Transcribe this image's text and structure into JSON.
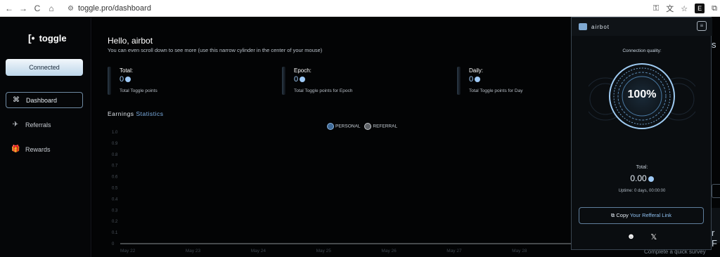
{
  "browser": {
    "url": "toggle.pro/dashboard",
    "nav_back": "←",
    "nav_forward": "→",
    "nav_reload": "C",
    "nav_home": "⌂",
    "star": "☆",
    "ext_label": "E"
  },
  "sidebar": {
    "logo_text": "toggle",
    "logo_mark": "[•",
    "connected_label": "Connected",
    "items": [
      {
        "label": "Dashboard",
        "icon": "⌘"
      },
      {
        "label": "Referrals",
        "icon": "✈"
      },
      {
        "label": "Rewards",
        "icon": "🎁"
      }
    ]
  },
  "main": {
    "greeting": "Hello, airbot",
    "subtitle": "You can even scroll down to see more (use this narrow cylinder in the center of your mouse)",
    "stats": [
      {
        "label": "Total:",
        "value": "0",
        "desc": "Total Toggle points"
      },
      {
        "label": "Epoch:",
        "value": "0",
        "desc": "Total Toggle points for Epoch"
      },
      {
        "label": "Daily:",
        "value": "0",
        "desc": "Total Toggle points for Day"
      }
    ],
    "earnings_title_1": "Earnings",
    "earnings_title_2": "Statistics"
  },
  "chart_data": {
    "type": "line",
    "title": "",
    "xlabel": "",
    "ylabel": "",
    "categories": [
      "May 22",
      "May 23",
      "May 24",
      "May 25",
      "May 26",
      "May 27",
      "May 28"
    ],
    "y_ticks": [
      "1.0",
      "0.9",
      "0.8",
      "0.7",
      "0.6",
      "0.5",
      "0.4",
      "0.3",
      "0.2",
      "0.1",
      "0"
    ],
    "ylim": [
      0,
      1
    ],
    "series": [
      {
        "name": "PERSONAL",
        "color": "#5b8fc4",
        "values": [
          0,
          0,
          0,
          0,
          0,
          0,
          0
        ]
      },
      {
        "name": "REFERRAL",
        "color": "#8a8f94",
        "values": [
          0,
          0,
          0,
          0,
          0,
          0,
          0
        ]
      }
    ],
    "legend": "top-center"
  },
  "popup": {
    "name": "airbot",
    "connection_label": "Connection quality:",
    "percent": "100%",
    "total_label": "Total:",
    "total_value": "0.00",
    "uptime": "Uptime: 0 days, 00:00:00",
    "copy_prefix": "Copy",
    "copy_link": "Your Refferal Link",
    "social_x": "𝕏"
  },
  "background": {
    "edge_s": "s",
    "edge_f": "r F",
    "survey": "Complete a quick survey"
  },
  "colors": {
    "accent": "#7fb2e8",
    "background": "#000000",
    "connected_btn": "#d8e8f5"
  }
}
